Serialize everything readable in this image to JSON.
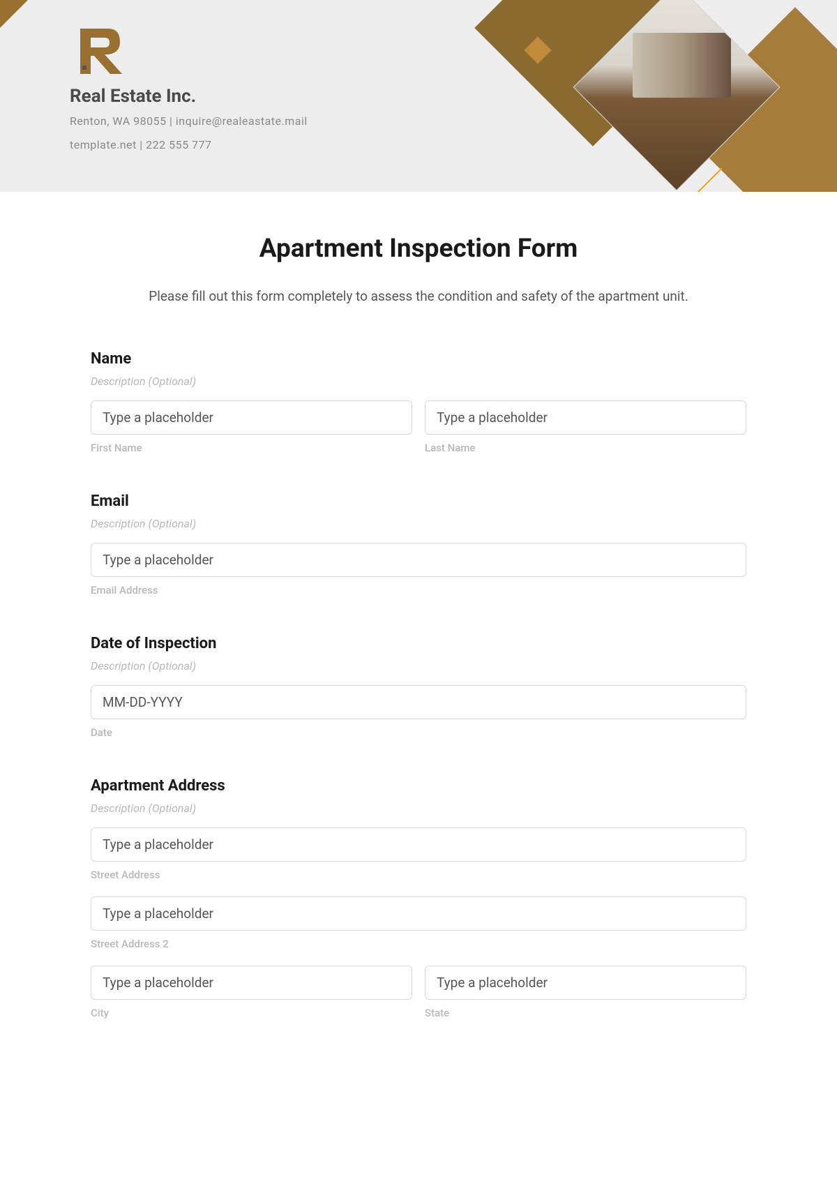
{
  "header": {
    "company_name": "Real Estate Inc.",
    "info_line1": "Renton, WA 98055 | inquire@realeastate.mail",
    "info_line2": "template.net | 222 555 777"
  },
  "brand_colors": {
    "primary": "#997030",
    "secondary": "#a67c3a",
    "accent": "#e8a030"
  },
  "form": {
    "title": "Apartment Inspection Form",
    "subtitle": "Please fill out this form completely to assess the condition and safety of the apartment unit.",
    "desc_optional": "Description (Optional)",
    "placeholder_generic": "Type a placeholder",
    "name": {
      "label": "Name",
      "first_sublabel": "First Name",
      "last_sublabel": "Last Name"
    },
    "email": {
      "label": "Email",
      "sublabel": "Email Address"
    },
    "date": {
      "label": "Date of Inspection",
      "placeholder": "MM-DD-YYYY",
      "sublabel": "Date"
    },
    "address": {
      "label": "Apartment Address",
      "street_sublabel": "Street Address",
      "street2_sublabel": "Street Address 2",
      "city_sublabel": "City",
      "state_sublabel": "State"
    }
  }
}
